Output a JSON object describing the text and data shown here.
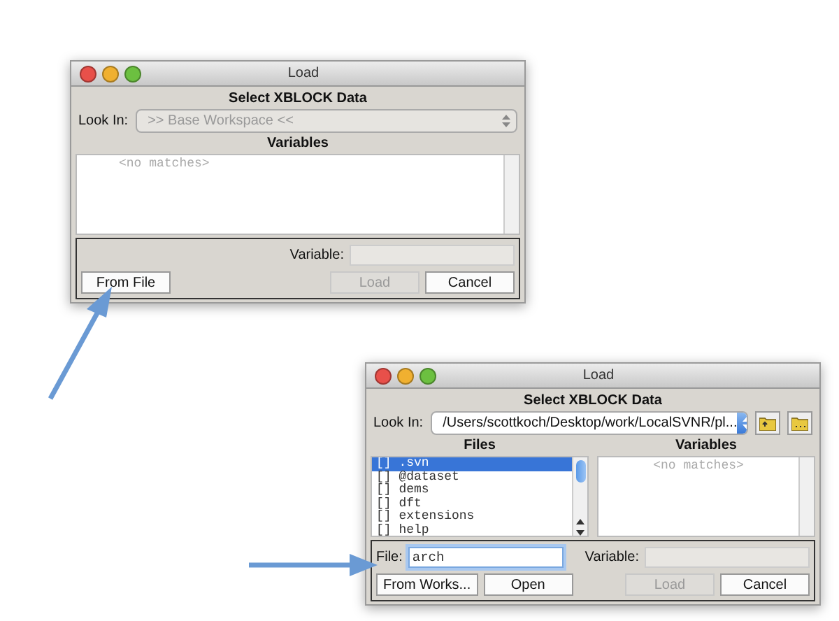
{
  "dialogs": [
    {
      "title": "Load",
      "heading": "Select XBLOCK Data",
      "look_in": {
        "label": "Look In:",
        "value": ">> Base Workspace <<",
        "disabled": true,
        "folder_buttons": false
      },
      "lists": [
        {
          "heading": "Variables",
          "empty_text": "<no matches>"
        }
      ],
      "variable_field": {
        "label": "Variable:"
      },
      "left_buttons": [
        {
          "label": "From File",
          "disabled": false
        }
      ],
      "right_buttons": [
        {
          "label": "Load",
          "disabled": true
        },
        {
          "label": "Cancel",
          "disabled": false
        }
      ]
    },
    {
      "title": "Load",
      "heading": "Select XBLOCK Data",
      "look_in": {
        "label": "Look In:",
        "value": "/Users/scottkoch/Desktop/work/LocalSVNR/pl...",
        "disabled": false,
        "folder_buttons": true
      },
      "lists": [
        {
          "heading": "Files",
          "items": [
            {
              "label": "[] .svn",
              "selected": true
            },
            {
              "label": "[] @dataset",
              "selected": false
            },
            {
              "label": "[] dems",
              "selected": false
            },
            {
              "label": "[] dft",
              "selected": false
            },
            {
              "label": "[] extensions",
              "selected": false
            },
            {
              "label": "[] help",
              "selected": false
            }
          ]
        },
        {
          "heading": "Variables",
          "empty_text": "<no matches>"
        }
      ],
      "file_field": {
        "label": "File:",
        "value": "arch"
      },
      "variable_field": {
        "label": "Variable:"
      },
      "left_buttons": [
        {
          "label": "From Works...",
          "disabled": false
        },
        {
          "label": "Open",
          "disabled": false
        }
      ],
      "right_buttons": [
        {
          "label": "Load",
          "disabled": true
        },
        {
          "label": "Cancel",
          "disabled": false
        }
      ]
    }
  ]
}
